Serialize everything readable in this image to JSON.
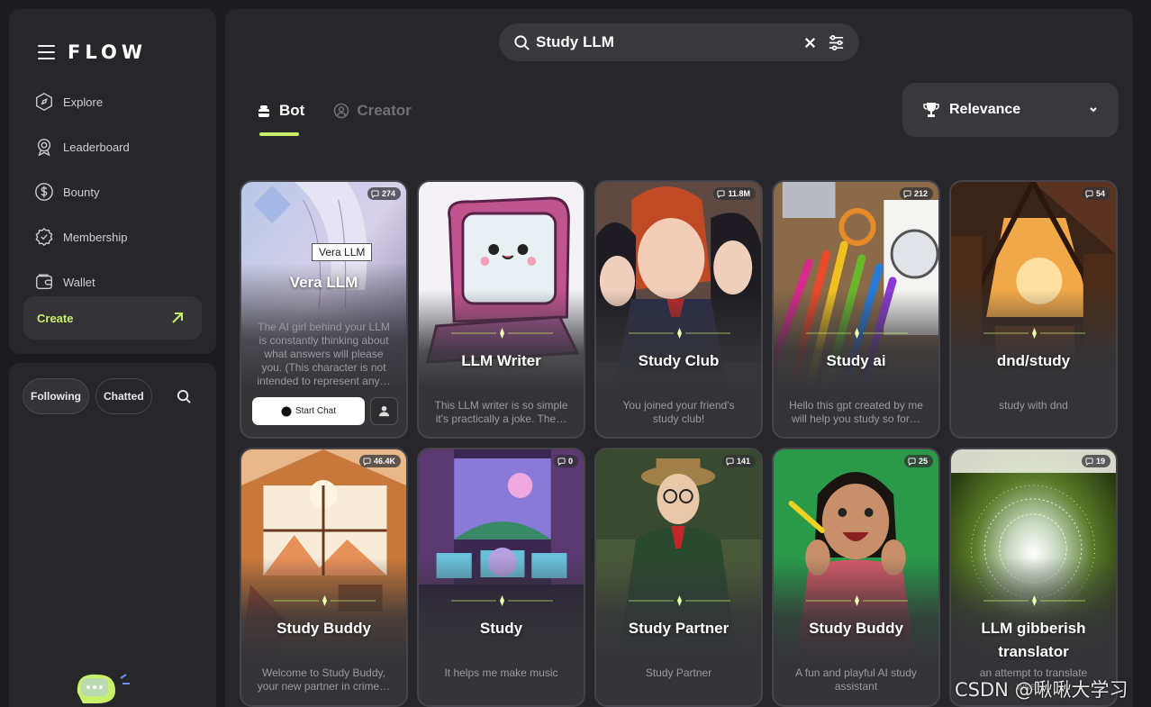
{
  "brand": "FLOW",
  "nav": [
    {
      "label": "Explore",
      "icon": "compass-icon"
    },
    {
      "label": "Leaderboard",
      "icon": "medal-icon"
    },
    {
      "label": "Bounty",
      "icon": "dollar-icon"
    },
    {
      "label": "Membership",
      "icon": "badge-check-icon"
    },
    {
      "label": "Wallet",
      "icon": "wallet-icon"
    }
  ],
  "create_label": "Create",
  "filters": {
    "following": "Following",
    "chatted": "Chatted"
  },
  "search": {
    "query": "Study LLM"
  },
  "tabs": {
    "bot": "Bot",
    "creator": "Creator"
  },
  "sort": {
    "label": "Relevance"
  },
  "colors": {
    "accent": "#c8f06a",
    "panel": "#27272b",
    "card": "#343438"
  },
  "cards": [
    {
      "title": "Vera LLM",
      "count": "274",
      "desc": "The AI girl behind your LLM is constantly thinking about what answers will please you. (This character is not intended to represent any…",
      "tooltip": "Vera LLM",
      "start_chat": "Start Chat"
    },
    {
      "title": "LLM Writer",
      "count": "",
      "desc": "This LLM writer is so simple it's practically a joke. The…"
    },
    {
      "title": "Study Club",
      "count": "11.8M",
      "desc": "You joined your friend's study club!"
    },
    {
      "title": "Study ai",
      "count": "212",
      "desc": "Hello this gpt created by me will help you study so for…"
    },
    {
      "title": "dnd/study",
      "count": "54",
      "desc": "study with dnd"
    },
    {
      "title": "Study Buddy",
      "count": "46.4K",
      "desc": "Welcome to Study Buddy, your new partner in crime…"
    },
    {
      "title": "Study",
      "count": "0",
      "desc": "It helps me make music"
    },
    {
      "title": "Study Partner",
      "count": "141",
      "desc": "Study Partner"
    },
    {
      "title": "Study Buddy",
      "count": "25",
      "desc": "A fun and playful AI study assistant"
    },
    {
      "title": "LLM gibberish translator",
      "count": "19",
      "desc": "an attempt to translate what…"
    }
  ],
  "watermark": "CSDN @啾啾大学习"
}
